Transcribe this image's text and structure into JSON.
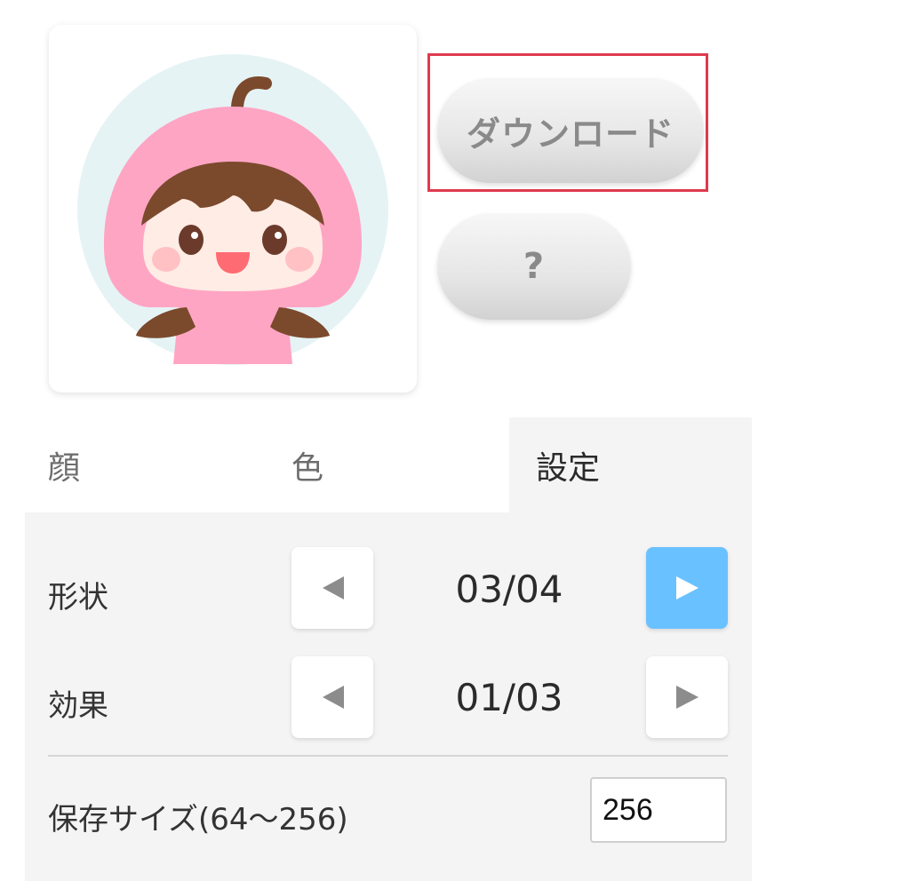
{
  "actions": {
    "download_label": "ダウンロード",
    "help_label": "?"
  },
  "tabs": [
    {
      "label": "顔"
    },
    {
      "label": "色"
    },
    {
      "label": "設定"
    }
  ],
  "active_tab": "設定",
  "settings": {
    "shape": {
      "label": "形状",
      "value": "03/04"
    },
    "effect": {
      "label": "効果",
      "value": "01/03"
    },
    "save_size": {
      "label": "保存サイズ(64〜256)",
      "value": "256"
    }
  },
  "colors": {
    "accent": "#6ac1ff",
    "highlight": "#e03a4e",
    "hood": "#ffa5c4",
    "hair": "#7b4a2d",
    "avatar_bg": "#e5f3f5"
  }
}
